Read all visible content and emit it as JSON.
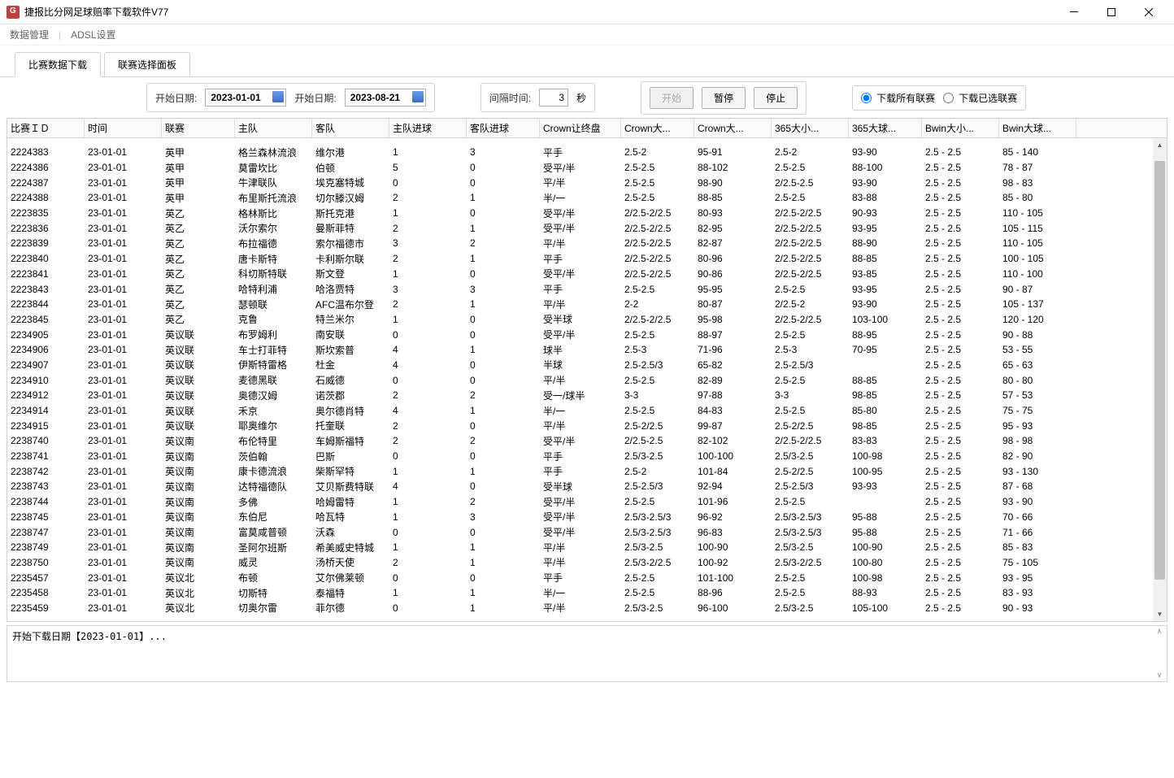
{
  "window": {
    "title": "捷报比分网足球赔率下载软件V77"
  },
  "menubar": {
    "dataManage": "数据管理",
    "adsl": "ADSL设置",
    "sep": "|"
  },
  "tabs": {
    "downloadData": "比赛数据下载",
    "leaguePanel": "联赛选择面板"
  },
  "toolbar": {
    "startDateLabel": "开始日期:",
    "startDate": "2023-01-01",
    "endDateLabel": "开始日期:",
    "endDate": "2023-08-21",
    "intervalLabel": "间隔时间:",
    "intervalValue": "3",
    "intervalUnit": "秒",
    "startBtn": "开始",
    "pauseBtn": "暂停",
    "stopBtn": "停止",
    "radioAll": "下载所有联赛",
    "radioSelected": "下载已选联赛"
  },
  "headers": [
    "比赛ＩＤ",
    "时间",
    "联赛",
    "主队",
    "客队",
    "主队进球",
    "客队进球",
    "Crown让终盘",
    "Crown大...",
    "Crown大...",
    "365大小...",
    "365大球...",
    "Bwin大小...",
    "Bwin大球..."
  ],
  "rows": [
    [
      "2224383",
      "23-01-01",
      "英甲",
      "格兰森林流浪",
      "维尔港",
      "1",
      "3",
      "平手",
      "2.5-2",
      "95-91",
      "2.5-2",
      "93-90",
      "2.5 - 2.5",
      "85 - 140"
    ],
    [
      "2224386",
      "23-01-01",
      "英甲",
      "莫雷坎比",
      "伯顿",
      "5",
      "0",
      "受平/半",
      "2.5-2.5",
      "88-102",
      "2.5-2.5",
      "88-100",
      "2.5 - 2.5",
      "78 - 87"
    ],
    [
      "2224387",
      "23-01-01",
      "英甲",
      "牛津联队",
      "埃克塞特城",
      "0",
      "0",
      "平/半",
      "2.5-2.5",
      "98-90",
      "2/2.5-2.5",
      "93-90",
      "2.5 - 2.5",
      "98 - 83"
    ],
    [
      "2224388",
      "23-01-01",
      "英甲",
      "布里斯托流浪",
      "切尔滕汉姆",
      "2",
      "1",
      "半/一",
      "2.5-2.5",
      "88-85",
      "2.5-2.5",
      "83-88",
      "2.5 - 2.5",
      "85 - 80"
    ],
    [
      "2223835",
      "23-01-01",
      "英乙",
      "格林斯比",
      "斯托克港",
      "1",
      "0",
      "受平/半",
      "2/2.5-2/2.5",
      "80-93",
      "2/2.5-2/2.5",
      "90-93",
      "2.5 - 2.5",
      "110 - 105"
    ],
    [
      "2223836",
      "23-01-01",
      "英乙",
      "沃尔索尔",
      "曼斯菲特",
      "2",
      "1",
      "受平/半",
      "2/2.5-2/2.5",
      "82-95",
      "2/2.5-2/2.5",
      "93-95",
      "2.5 - 2.5",
      "105 - 115"
    ],
    [
      "2223839",
      "23-01-01",
      "英乙",
      "布拉福德",
      "索尔福德市",
      "3",
      "2",
      "平/半",
      "2/2.5-2/2.5",
      "82-87",
      "2/2.5-2/2.5",
      "88-90",
      "2.5 - 2.5",
      "110 - 105"
    ],
    [
      "2223840",
      "23-01-01",
      "英乙",
      "唐卡斯特",
      "卡利斯尔联",
      "2",
      "1",
      "平手",
      "2/2.5-2/2.5",
      "80-96",
      "2/2.5-2/2.5",
      "88-85",
      "2.5 - 2.5",
      "100 - 105"
    ],
    [
      "2223841",
      "23-01-01",
      "英乙",
      "科切斯特联",
      "斯文登",
      "1",
      "0",
      "受平/半",
      "2/2.5-2/2.5",
      "90-86",
      "2/2.5-2/2.5",
      "93-85",
      "2.5 - 2.5",
      "110 - 100"
    ],
    [
      "2223843",
      "23-01-01",
      "英乙",
      "哈特利浦",
      "哈洛贾特",
      "3",
      "3",
      "平手",
      "2.5-2.5",
      "95-95",
      "2.5-2.5",
      "93-95",
      "2.5 - 2.5",
      "90 - 87"
    ],
    [
      "2223844",
      "23-01-01",
      "英乙",
      "瑟顿联",
      "AFC温布尔登",
      "2",
      "1",
      "平/半",
      "2-2",
      "80-87",
      "2/2.5-2",
      "93-90",
      "2.5 - 2.5",
      "105 - 137"
    ],
    [
      "2223845",
      "23-01-01",
      "英乙",
      "克鲁",
      "特兰米尔",
      "1",
      "0",
      "受半球",
      "2/2.5-2/2.5",
      "95-98",
      "2/2.5-2/2.5",
      "103-100",
      "2.5 - 2.5",
      "120 - 120"
    ],
    [
      "2234905",
      "23-01-01",
      "英议联",
      "布罗姆利",
      "南安联",
      "0",
      "0",
      "受平/半",
      "2.5-2.5",
      "88-97",
      "2.5-2.5",
      "88-95",
      "2.5 - 2.5",
      "90 - 88"
    ],
    [
      "2234906",
      "23-01-01",
      "英议联",
      "车士打菲特",
      "斯坎索普",
      "4",
      "1",
      "球半",
      "2.5-3",
      "71-96",
      "2.5-3",
      "70-95",
      "2.5 - 2.5",
      "53 - 55"
    ],
    [
      "2234907",
      "23-01-01",
      "英议联",
      "伊斯特雷格",
      "杜金",
      "4",
      "0",
      "半球",
      "2.5-2.5/3",
      "65-82",
      "2.5-2.5/3",
      "",
      "2.5 - 2.5",
      "65 - 63"
    ],
    [
      "2234910",
      "23-01-01",
      "英议联",
      "麦德黑联",
      "石威德",
      "0",
      "0",
      "平/半",
      "2.5-2.5",
      "82-89",
      "2.5-2.5",
      "88-85",
      "2.5 - 2.5",
      "80 - 80"
    ],
    [
      "2234912",
      "23-01-01",
      "英议联",
      "奥德汉姆",
      "诺茨郡",
      "2",
      "2",
      "受一/球半",
      "3-3",
      "97-88",
      "3-3",
      "98-85",
      "2.5 - 2.5",
      "57 - 53"
    ],
    [
      "2234914",
      "23-01-01",
      "英议联",
      "禾京",
      "奥尔德肖特",
      "4",
      "1",
      "半/一",
      "2.5-2.5",
      "84-83",
      "2.5-2.5",
      "85-80",
      "2.5 - 2.5",
      "75 - 75"
    ],
    [
      "2234915",
      "23-01-01",
      "英议联",
      "耶奥维尔",
      "托奎联",
      "2",
      "0",
      "平/半",
      "2.5-2/2.5",
      "99-87",
      "2.5-2/2.5",
      "98-85",
      "2.5 - 2.5",
      "95 - 93"
    ],
    [
      "2238740",
      "23-01-01",
      "英议南",
      "布伦特里",
      "车姆斯福特",
      "2",
      "2",
      "受平/半",
      "2/2.5-2.5",
      "82-102",
      "2/2.5-2/2.5",
      "83-83",
      "2.5 - 2.5",
      "98 - 98"
    ],
    [
      "2238741",
      "23-01-01",
      "英议南",
      "茨伯翰",
      "巴斯",
      "0",
      "0",
      "平手",
      "2.5/3-2.5",
      "100-100",
      "2.5/3-2.5",
      "100-98",
      "2.5 - 2.5",
      "82 - 90"
    ],
    [
      "2238742",
      "23-01-01",
      "英议南",
      "康卡德流浪",
      "柴斯罕特",
      "1",
      "1",
      "平手",
      "2.5-2",
      "101-84",
      "2.5-2/2.5",
      "100-95",
      "2.5 - 2.5",
      "93 - 130"
    ],
    [
      "2238743",
      "23-01-01",
      "英议南",
      "达特福德队",
      "艾贝斯费特联",
      "4",
      "0",
      "受半球",
      "2.5-2.5/3",
      "92-94",
      "2.5-2.5/3",
      "93-93",
      "2.5 - 2.5",
      "87 - 68"
    ],
    [
      "2238744",
      "23-01-01",
      "英议南",
      "多佛",
      "哈姆雷特",
      "1",
      "2",
      "受平/半",
      "2.5-2.5",
      "101-96",
      "2.5-2.5",
      "",
      "2.5 - 2.5",
      "93 - 90"
    ],
    [
      "2238745",
      "23-01-01",
      "英议南",
      "东伯尼",
      "哈瓦特",
      "1",
      "3",
      "受平/半",
      "2.5/3-2.5/3",
      "96-92",
      "2.5/3-2.5/3",
      "95-88",
      "2.5 - 2.5",
      "70 - 66"
    ],
    [
      "2238747",
      "23-01-01",
      "英议南",
      "富莫咸普顿",
      "沃森",
      "0",
      "0",
      "受平/半",
      "2.5/3-2.5/3",
      "96-83",
      "2.5/3-2.5/3",
      "95-88",
      "2.5 - 2.5",
      "71 - 66"
    ],
    [
      "2238749",
      "23-01-01",
      "英议南",
      "圣阿尔班斯",
      "希美威史特城",
      "1",
      "1",
      "平/半",
      "2.5/3-2.5",
      "100-90",
      "2.5/3-2.5",
      "100-90",
      "2.5 - 2.5",
      "85 - 83"
    ],
    [
      "2238750",
      "23-01-01",
      "英议南",
      "威灵",
      "汤桥天使",
      "2",
      "1",
      "平/半",
      "2.5/3-2/2.5",
      "100-92",
      "2.5/3-2/2.5",
      "100-80",
      "2.5 - 2.5",
      "75 - 105"
    ],
    [
      "2235457",
      "23-01-01",
      "英议北",
      "布顿",
      "艾尔佛莱顿",
      "0",
      "0",
      "平手",
      "2.5-2.5",
      "101-100",
      "2.5-2.5",
      "100-98",
      "2.5 - 2.5",
      "93 - 95"
    ],
    [
      "2235458",
      "23-01-01",
      "英议北",
      "切斯特",
      "泰福特",
      "1",
      "1",
      "半/一",
      "2.5-2.5",
      "88-96",
      "2.5-2.5",
      "88-93",
      "2.5 - 2.5",
      "83 - 93"
    ],
    [
      "2235459",
      "23-01-01",
      "英议北",
      "切奥尔雷",
      "菲尔德",
      "0",
      "1",
      "平/半",
      "2.5/3-2.5",
      "96-100",
      "2.5/3-2.5",
      "105-100",
      "2.5 - 2.5",
      "90 - 93"
    ]
  ],
  "log": {
    "line1": "开始下载日期【2023-01-01】..."
  }
}
